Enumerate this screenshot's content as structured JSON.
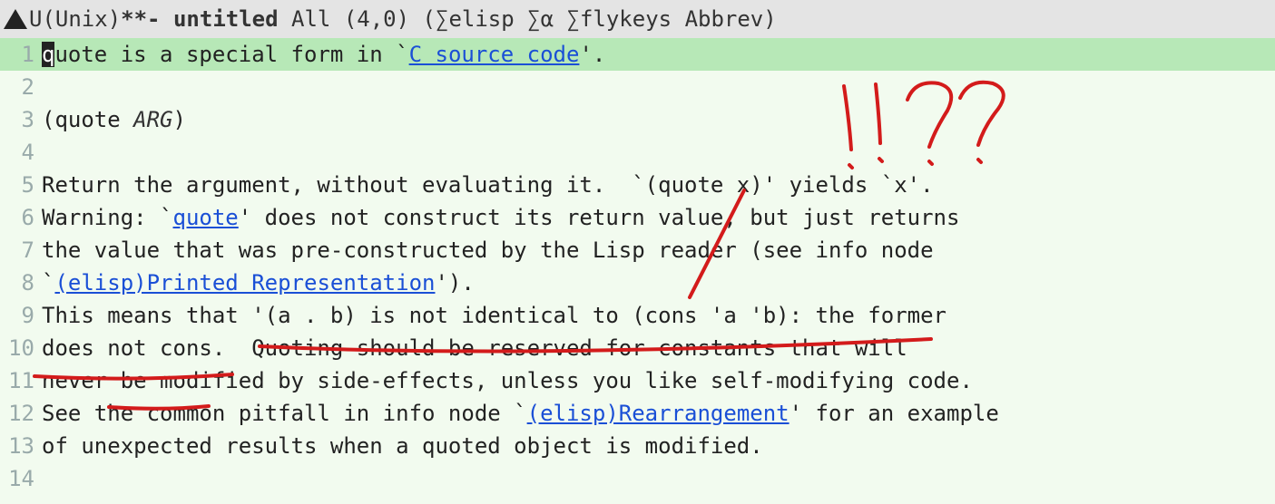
{
  "modeline": {
    "encoding": "U(Unix)",
    "modified": "**-",
    "buffer_name": "untitled",
    "narrow": "All",
    "position": "(4,0)",
    "modes_prefix": "(",
    "sigma": "∑",
    "mode1": "elisp",
    "mode2": "α",
    "mode3": "flykeys",
    "mode4": "Abbrev",
    "modes_suffix": ")"
  },
  "lines": [
    {
      "n": "1",
      "segments": [
        {
          "t": "q",
          "cls": "cursor"
        },
        {
          "t": "uote is a special form in `"
        },
        {
          "t": "C source code",
          "cls": "link",
          "name": "link-c-source-code"
        },
        {
          "t": "'."
        }
      ],
      "hl": true
    },
    {
      "n": "2",
      "segments": [
        {
          "t": ""
        }
      ]
    },
    {
      "n": "3",
      "segments": [
        {
          "t": "(quote "
        },
        {
          "t": "ARG",
          "cls": "arg"
        },
        {
          "t": ")"
        }
      ]
    },
    {
      "n": "4",
      "segments": [
        {
          "t": ""
        }
      ]
    },
    {
      "n": "5",
      "segments": [
        {
          "t": "Return the argument, without evaluating it.  `(quote x)' yields `x'."
        }
      ]
    },
    {
      "n": "6",
      "segments": [
        {
          "t": "Warning: `"
        },
        {
          "t": "quote",
          "cls": "link",
          "name": "link-quote"
        },
        {
          "t": "' does not construct its return value, but just returns"
        }
      ]
    },
    {
      "n": "7",
      "segments": [
        {
          "t": "the value that was pre-constructed by the Lisp reader (see info node"
        }
      ]
    },
    {
      "n": "8",
      "segments": [
        {
          "t": "`"
        },
        {
          "t": "(elisp)Printed Representation",
          "cls": "link",
          "name": "link-printed-representation"
        },
        {
          "t": "')."
        }
      ]
    },
    {
      "n": "9",
      "segments": [
        {
          "t": "This means that '(a . b) is not identical to (cons 'a 'b): the former"
        }
      ]
    },
    {
      "n": "10",
      "segments": [
        {
          "t": "does not cons.  Quoting should be reserved for constants that will"
        }
      ]
    },
    {
      "n": "11",
      "segments": [
        {
          "t": "never be modified by side-effects, unless you like self-modifying code."
        }
      ]
    },
    {
      "n": "12",
      "segments": [
        {
          "t": "See the common pitfall in info node `"
        },
        {
          "t": "(elisp)Rearrangement",
          "cls": "link",
          "name": "link-rearrangement"
        },
        {
          "t": "' for an example"
        }
      ]
    },
    {
      "n": "13",
      "segments": [
        {
          "t": "of unexpected results when a quoted object is modified."
        }
      ]
    },
    {
      "n": "14",
      "segments": [
        {
          "t": ""
        }
      ]
    }
  ],
  "annotation_label": "!!??"
}
